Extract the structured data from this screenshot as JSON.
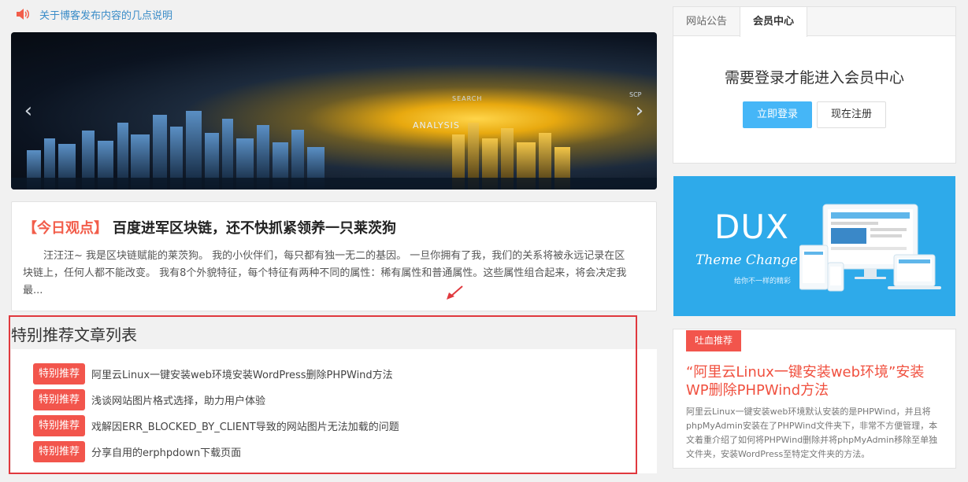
{
  "notice": {
    "icon": "speaker-icon",
    "text": "关于博客发布内容的几点说明",
    "color": "#3a8cc8"
  },
  "slider": {
    "prev_icon": "chevron-left-icon",
    "next_icon": "chevron-right-icon",
    "overlay_text": {
      "analysis": "ANALYSIS",
      "search": "SEARCH",
      "marketing": "SCP"
    },
    "slide_count": 5,
    "active_index": 3
  },
  "featured": {
    "tag": "【今日观点】",
    "title": "百度进军区块链，还不快抓紧领养一只莱茨狗",
    "excerpt": "汪汪汪~ 我是区块链赋能的莱茨狗。 我的小伙伴们，每只都有独一无二的基因。 一旦你拥有了我，我们的关系将被永远记录在区块链上，任何人都不能改变。 我有8个外貌特征，每个特征有两种不同的属性：稀有属性和普通属性。这些属性组合起来，将会决定我最..."
  },
  "special": {
    "title": "特别推荐文章列表",
    "badge": "特别推荐",
    "items": [
      "阿里云Linux一键安装web环境安装WordPress删除PHPWind方法",
      "浅谈网站图片格式选择，助力用户体验",
      "戏解因ERR_BLOCKED_BY_CLIENT导致的网站图片无法加载的问题",
      " 分享自用的erphpdown下载页面"
    ]
  },
  "sidebar": {
    "tabs": [
      "网站公告",
      "会员中心"
    ],
    "active_tab": 1,
    "member_message": "需要登录才能进入会员中心",
    "login_label": "立即登录",
    "register_label": "现在注册",
    "banner": {
      "title": "DUX",
      "subtitle": "Theme Change",
      "tagline": "给你不一样的精彩"
    },
    "recommend": {
      "tag": "吐血推荐",
      "title": "“阿里云Linux一键安装web环境”安装WP删除PHPWind方法",
      "excerpt": "阿里云Linux一键安装web环境默认安装的是PHPWind，并且将phpMyAdmin安装在了PHPWind文件夹下，非常不方便管理，本文着重介绍了如何将PHPWind删除并将phpMyAdmin移除至单独文件夹，安装WordPress至特定文件夹的方法。"
    }
  },
  "colors": {
    "accent_red": "#f2554c",
    "accent_blue": "#45b6f7",
    "banner_blue": "#2eaaea",
    "highlight_box": "#e0393e"
  }
}
